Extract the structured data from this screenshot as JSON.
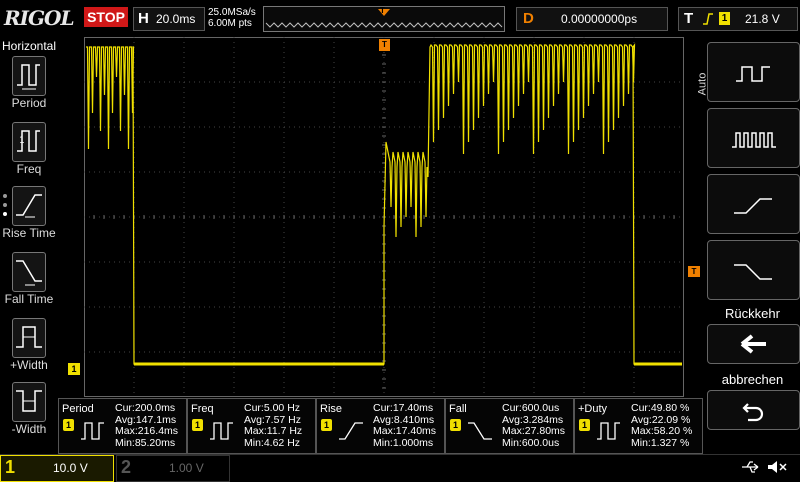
{
  "brand": "RIGOL",
  "run_state": "STOP",
  "timebase": {
    "letter": "H",
    "value": "20.0ms"
  },
  "acquisition": {
    "sample_rate": "25.0MSa/s",
    "memory_depth": "6.00M pts"
  },
  "delay": {
    "letter": "D",
    "value": "0.00000000ps"
  },
  "trigger": {
    "letter": "T",
    "source": "1",
    "level": "21.8 V"
  },
  "colors": {
    "ch1": "#f0e000",
    "stop": "#d01818",
    "trigger_marker": "#f08000"
  },
  "left_panel": {
    "title": "Horizontal",
    "items": [
      {
        "label": "Period",
        "icon": "period-icon"
      },
      {
        "label": "Freq",
        "icon": "freq-icon"
      },
      {
        "label": "Rise Time",
        "icon": "rise-time-icon"
      },
      {
        "label": "Fall Time",
        "icon": "fall-time-icon"
      },
      {
        "label": "+Width",
        "icon": "pos-width-icon"
      },
      {
        "label": "-Width",
        "icon": "neg-width-icon"
      }
    ]
  },
  "right_panel": {
    "auto_label": "Auto",
    "back_label": "Rückkehr",
    "cancel_label": "abbrechen"
  },
  "markers": {
    "ch1_ground": "1",
    "trigger_level": "T",
    "trigger_position": "T"
  },
  "measurements": [
    {
      "name": "Period",
      "cur": "Cur:200.0ms",
      "avg": "Avg:147.1ms",
      "max": "Max:216.4ms",
      "min": "Min:85.20ms",
      "channel": "1"
    },
    {
      "name": "Freq",
      "cur": "Cur:5.00 Hz",
      "avg": "Avg:7.57 Hz",
      "max": "Max:11.7 Hz",
      "min": "Min:4.62 Hz",
      "channel": "1"
    },
    {
      "name": "Rise",
      "cur": "Cur:17.40ms",
      "avg": "Avg:8.410ms",
      "max": "Max:17.40ms",
      "min": "Min:1.000ms",
      "channel": "1"
    },
    {
      "name": "Fall",
      "cur": "Cur:600.0us",
      "avg": "Avg:3.284ms",
      "max": "Max:27.80ms",
      "min": "Min:600.0us",
      "channel": "1"
    },
    {
      "name": "+Duty",
      "cur": "Cur:49.80 %",
      "avg": "Avg:22.09 %",
      "max": "Max:58.20 %",
      "min": "Min:1.327 %",
      "channel": "1"
    }
  ],
  "channels": [
    {
      "number": "1",
      "scale": "10.0 V",
      "active": true
    },
    {
      "number": "2",
      "scale": "1.00 V",
      "active": false
    }
  ]
}
